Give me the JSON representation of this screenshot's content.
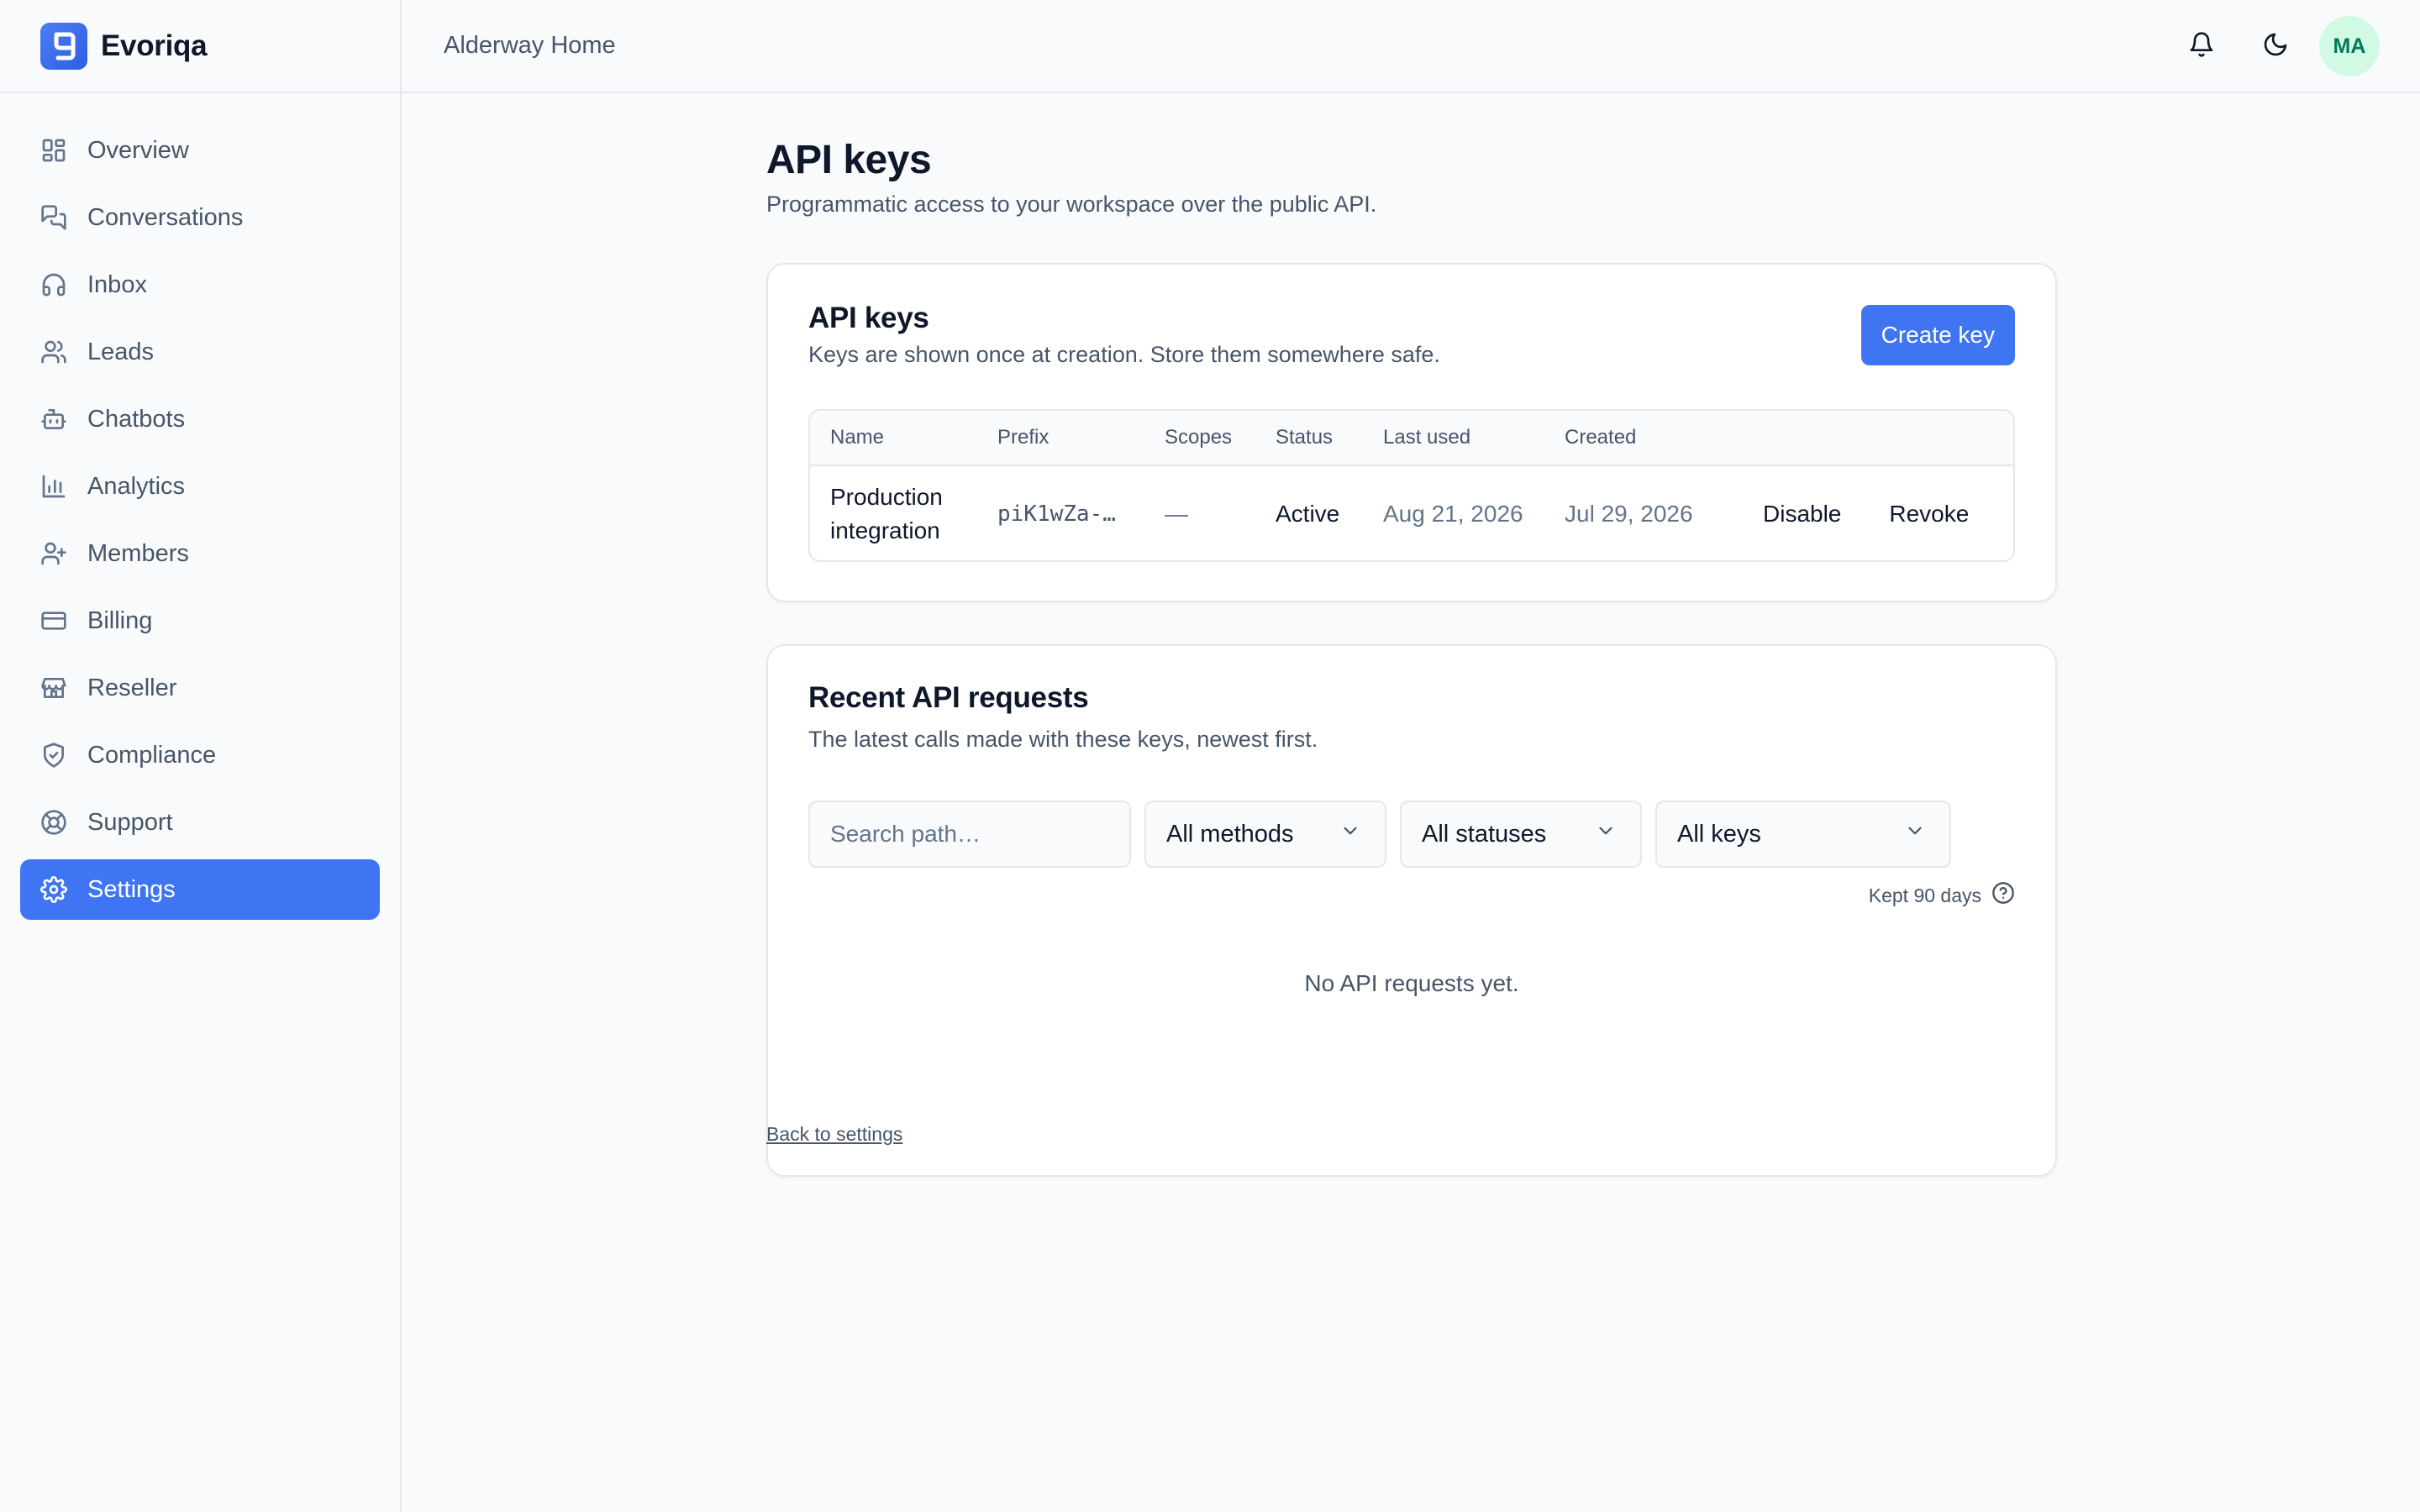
{
  "brand": {
    "name": "Evoriqa",
    "logo_icon": "brand-logo-icon"
  },
  "sidebar": {
    "items": [
      {
        "label": "Overview",
        "icon": "grid-icon",
        "active": false
      },
      {
        "label": "Conversations",
        "icon": "chat-icon",
        "active": false
      },
      {
        "label": "Inbox",
        "icon": "headset-icon",
        "active": false
      },
      {
        "label": "Leads",
        "icon": "users-icon",
        "active": false
      },
      {
        "label": "Chatbots",
        "icon": "bot-icon",
        "active": false
      },
      {
        "label": "Analytics",
        "icon": "bar-chart-icon",
        "active": false
      },
      {
        "label": "Members",
        "icon": "user-plus-icon",
        "active": false
      },
      {
        "label": "Billing",
        "icon": "credit-card-icon",
        "active": false
      },
      {
        "label": "Reseller",
        "icon": "store-icon",
        "active": false
      },
      {
        "label": "Compliance",
        "icon": "shield-icon",
        "active": false
      },
      {
        "label": "Support",
        "icon": "lifebuoy-icon",
        "active": false
      },
      {
        "label": "Settings",
        "icon": "gear-icon",
        "active": true
      }
    ],
    "active_color": "#3f75f2"
  },
  "topbar": {
    "workspace": "Alderway Home",
    "avatar_initials": "MA"
  },
  "page": {
    "title": "API keys",
    "subtitle": "Programmatic access to your workspace over the public API."
  },
  "keys_card": {
    "title": "API keys",
    "subtitle": "Keys are shown once at creation. Store them somewhere safe.",
    "create_label": "Create key",
    "columns": [
      "Name",
      "Prefix",
      "Scopes",
      "Status",
      "Last used",
      "Created"
    ],
    "rows": [
      {
        "name_line1": "Production",
        "name_line2": "integration",
        "prefix": "piK1wZa-…",
        "scopes": "—",
        "status": "Active",
        "last_used": "Aug 21, 2026",
        "created": "Jul 29, 2026",
        "actions": [
          "Disable",
          "Revoke"
        ]
      }
    ]
  },
  "requests_card": {
    "title": "Recent API requests",
    "subtitle": "The latest calls made with these keys, newest first.",
    "search_placeholder": "Search path…",
    "method_filter": "All methods",
    "status_filter": "All statuses",
    "key_filter": "All keys",
    "retention": "Kept 90 days",
    "empty_text": "No API requests yet."
  },
  "back_link": "Back to settings",
  "colors": {
    "accent": "#3f75f2",
    "avatar_bg": "#d1fae5",
    "avatar_text": "#047857"
  }
}
